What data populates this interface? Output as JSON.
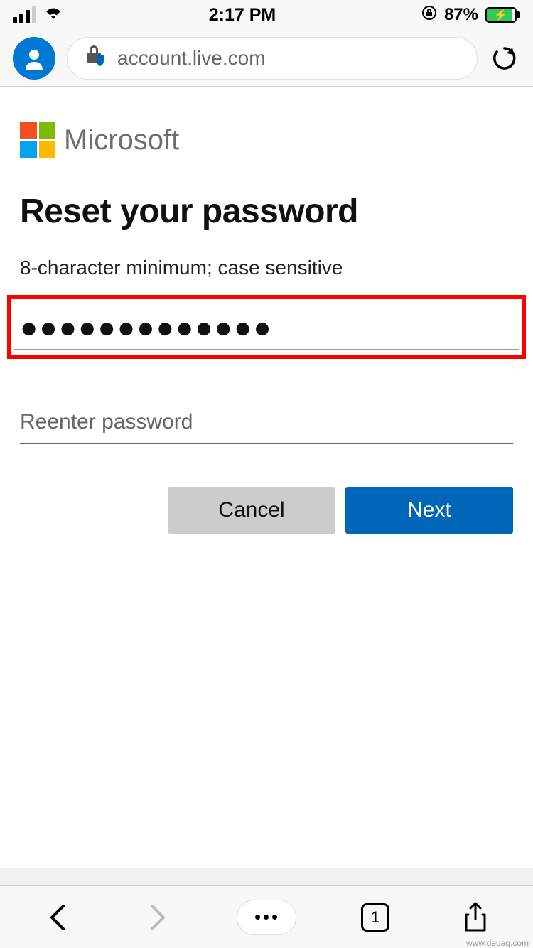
{
  "status_bar": {
    "time": "2:17 PM",
    "battery_pct": "87%"
  },
  "browser": {
    "url": "account.live.com",
    "tab_count": "1"
  },
  "brand_name": "Microsoft",
  "page_title": "Reset your password",
  "requirements": "8-character minimum; case sensitive",
  "password_input": {
    "value": "●●●●●●●●●●●●●"
  },
  "reenter_input": {
    "placeholder": "Reenter password",
    "value": ""
  },
  "buttons": {
    "cancel": "Cancel",
    "next": "Next"
  },
  "watermark": "www.deuaq.com"
}
